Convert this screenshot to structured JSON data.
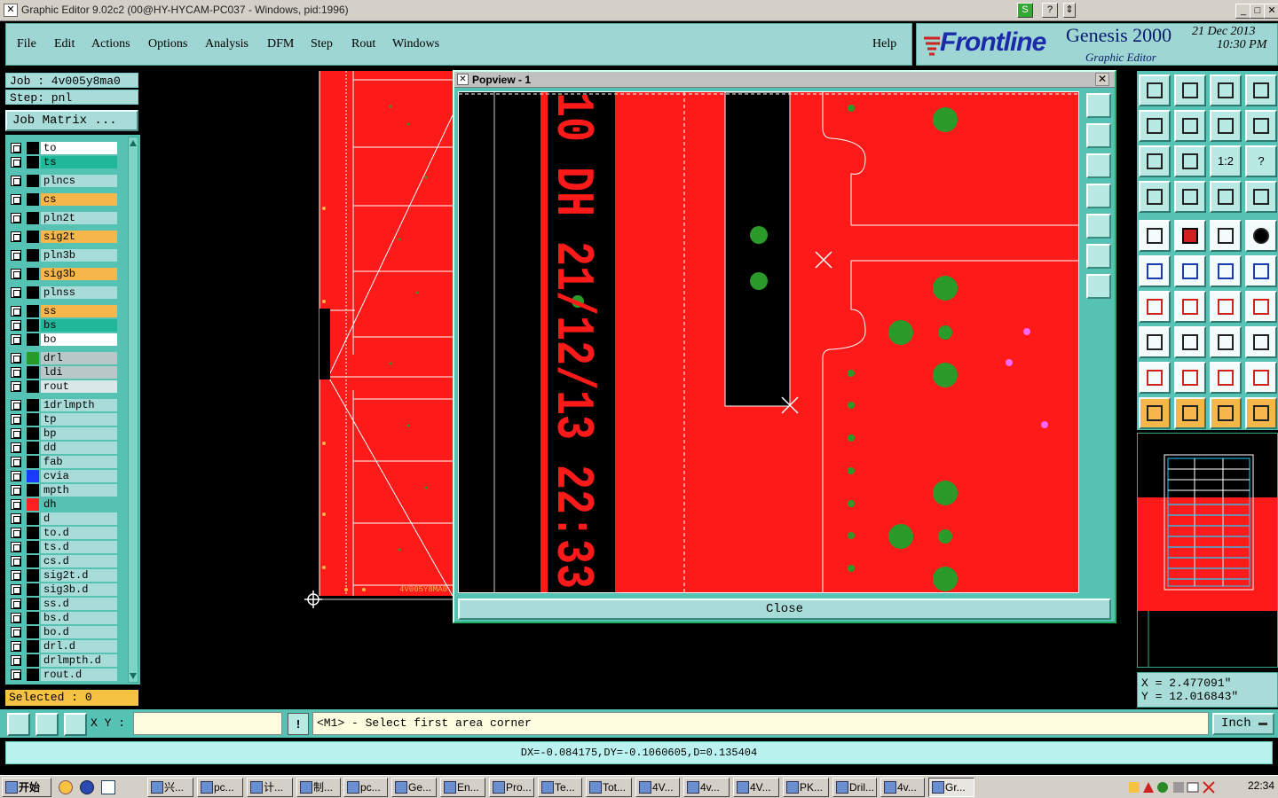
{
  "titlebar": {
    "title": "Graphic Editor 9.02c2 (00@HY-HYCAM-PC037 - Windows, pid:1996)",
    "minimize": "_",
    "maximize": "□",
    "close": "✕"
  },
  "menu": {
    "items": [
      "File",
      "Edit",
      "Actions",
      "Options",
      "Analysis",
      "DFM",
      "Step",
      "Rout",
      "Windows"
    ],
    "help": "Help"
  },
  "brand": {
    "logo": "Frontline",
    "product": "Genesis 2000",
    "subtitle": "Graphic Editor",
    "date": "21 Dec 2013",
    "time": "10:30 PM"
  },
  "job": {
    "job_line": "Job : 4v005y8ma0",
    "step_line": "Step: pnl",
    "job_matrix": "Job Matrix ..."
  },
  "layers": [
    {
      "name": "to",
      "bg": "#ffffff",
      "color": ""
    },
    {
      "name": "ts",
      "bg": "#1fb89a",
      "color": ""
    },
    {
      "name": "plncs",
      "bg": "#a8dcd9",
      "color": ""
    },
    {
      "name": "cs",
      "bg": "#f5b74a",
      "color": ""
    },
    {
      "name": "pln2t",
      "bg": "#a8dcd9",
      "color": ""
    },
    {
      "name": "sig2t",
      "bg": "#f5b74a",
      "color": ""
    },
    {
      "name": "pln3b",
      "bg": "#a8dcd9",
      "color": ""
    },
    {
      "name": "sig3b",
      "bg": "#f5b74a",
      "color": ""
    },
    {
      "name": "plnss",
      "bg": "#a8dcd9",
      "color": ""
    },
    {
      "name": "ss",
      "bg": "#f5b74a",
      "color": ""
    },
    {
      "name": "bs",
      "bg": "#1fb89a",
      "color": ""
    },
    {
      "name": "bo",
      "bg": "#ffffff",
      "color": ""
    },
    {
      "name": "drl",
      "bg": "#b8c8c8",
      "color": "#2a9a2a"
    },
    {
      "name": "ldi",
      "bg": "#b8c8c8",
      "color": ""
    },
    {
      "name": "rout",
      "bg": "#d8e8e8",
      "color": ""
    },
    {
      "name": "1drlmpth",
      "bg": "#a8dcd9",
      "color": ""
    },
    {
      "name": "tp",
      "bg": "#a8dcd9",
      "color": ""
    },
    {
      "name": "bp",
      "bg": "#a8dcd9",
      "color": ""
    },
    {
      "name": "dd",
      "bg": "#a8dcd9",
      "color": ""
    },
    {
      "name": "fab",
      "bg": "#a8dcd9",
      "color": ""
    },
    {
      "name": "cvia",
      "bg": "#a8dcd9",
      "color": "#1a3aff"
    },
    {
      "name": "mpth",
      "bg": "#a8dcd9",
      "color": ""
    },
    {
      "name": "dh",
      "bg": "#55c2b4",
      "color": "#ff2020"
    },
    {
      "name": "d",
      "bg": "#a8dcd9",
      "color": ""
    },
    {
      "name": "to.d",
      "bg": "#a8dcd9",
      "color": ""
    },
    {
      "name": "ts.d",
      "bg": "#a8dcd9",
      "color": ""
    },
    {
      "name": "cs.d",
      "bg": "#a8dcd9",
      "color": ""
    },
    {
      "name": "sig2t.d",
      "bg": "#a8dcd9",
      "color": ""
    },
    {
      "name": "sig3b.d",
      "bg": "#a8dcd9",
      "color": ""
    },
    {
      "name": "ss.d",
      "bg": "#a8dcd9",
      "color": ""
    },
    {
      "name": "bs.d",
      "bg": "#a8dcd9",
      "color": ""
    },
    {
      "name": "bo.d",
      "bg": "#a8dcd9",
      "color": ""
    },
    {
      "name": "drl.d",
      "bg": "#a8dcd9",
      "color": ""
    },
    {
      "name": "drlmpth.d",
      "bg": "#a8dcd9",
      "color": ""
    },
    {
      "name": "rout.d",
      "bg": "#a8dcd9",
      "color": ""
    }
  ],
  "selected": "Selected : 0",
  "popview": {
    "title": "Popview - 1",
    "close_label": "Close",
    "stamp_text": "10 DH 21/12/13 22:33"
  },
  "board": {
    "edge_text": "4V005Y8MA0"
  },
  "tools": {
    "one_to_one": "1:2",
    "help": "?"
  },
  "coords": {
    "x": "X = 2.477091\"",
    "y": "Y = 12.016843\""
  },
  "command": {
    "xy_label": "X Y :",
    "xy_value": "",
    "bang": "!",
    "prompt": "<M1> - Select first area corner",
    "units": "Inch"
  },
  "status": "DX=-0.084175,DY=-0.1060605,D=0.135404",
  "taskbar": {
    "start": "开始",
    "tasks": [
      "兴...",
      "pc...",
      "计...",
      "制...",
      "pc...",
      "Ge...",
      "En...",
      "Pro...",
      "Te...",
      "Tot...",
      "4V...",
      "4v...",
      "4V...",
      "PK...",
      "Dril...",
      "4v...",
      "Gr..."
    ],
    "clock": "22:34"
  }
}
